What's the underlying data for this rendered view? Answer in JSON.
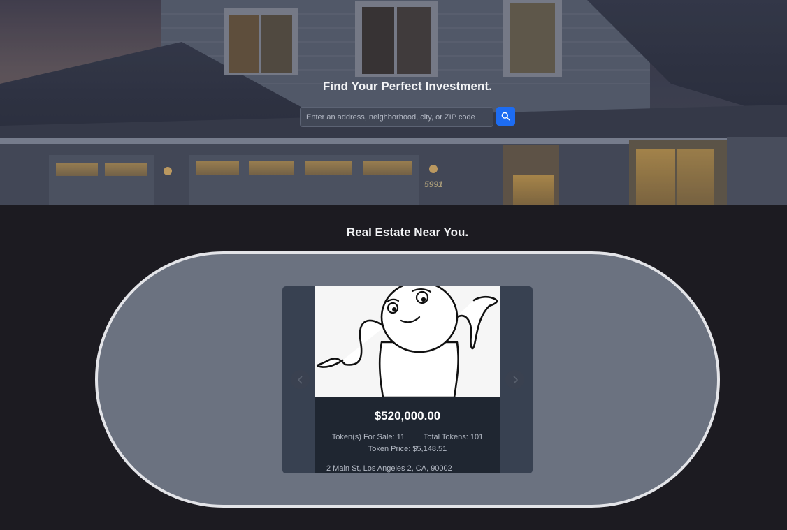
{
  "hero": {
    "title": "Find Your Perfect Investment.",
    "search_placeholder": "Enter an address, neighborhood, city, or ZIP code",
    "search_icon": "search-icon",
    "house_number": "5991"
  },
  "listings": {
    "title": "Real Estate Near You.",
    "card": {
      "price": "$520,000.00",
      "tokens_for_sale": "Token(s) For Sale: 11",
      "separator": "|",
      "total_tokens": "Total Tokens: 101",
      "token_price": "Token Price: $5,148.51",
      "address": "2 Main St, Los Angeles 2, CA, 90002"
    },
    "prev_icon": "chevron-left-icon",
    "next_icon": "chevron-right-icon"
  },
  "colors": {
    "background": "#1c1b21",
    "accent": "#1d6cf2",
    "pill": "#6b7280",
    "card": "#1f2631"
  }
}
